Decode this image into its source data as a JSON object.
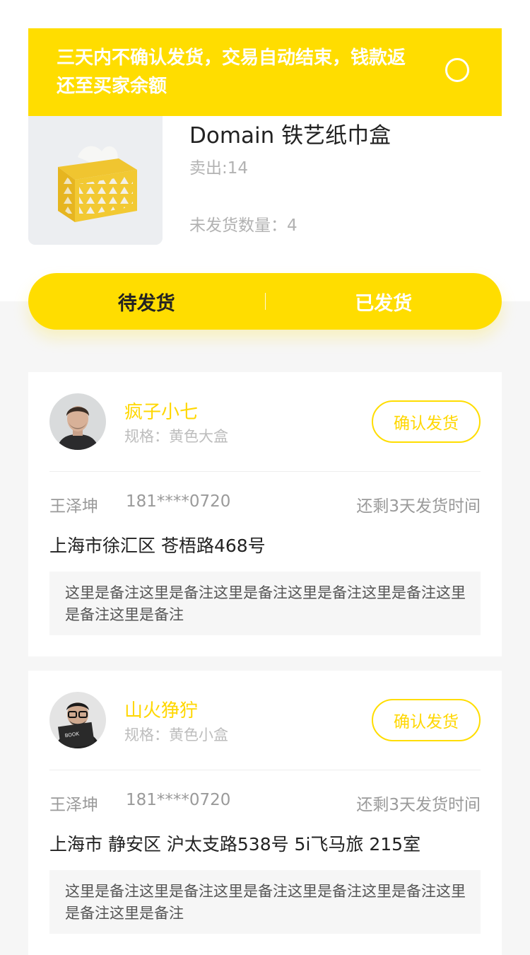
{
  "notice": {
    "text": "三天内不确认发货，交易自动结束，钱款返还至买家余额"
  },
  "product": {
    "title": "Domain 铁艺纸巾盒",
    "sold": "卖出:14",
    "unshipped": "未发货数量：4"
  },
  "tabs": {
    "pending": "待发货",
    "shipped": "已发货",
    "active": "pending"
  },
  "orders": [
    {
      "buyer": "疯子小七",
      "spec": "规格：黄色大盒",
      "confirm": "确认发货",
      "recipient": "王泽坤",
      "phone": "181****0720",
      "remaining": "还剩3天发货时间",
      "address": "上海市徐汇区 苍梧路468号",
      "remark": "这里是备注这里是备注这里是备注这里是备注这里是备注这里是备注这里是备注"
    },
    {
      "buyer": "山火狰狞",
      "spec": "规格：黄色小盒",
      "confirm": "确认发货",
      "recipient": "王泽坤",
      "phone": "181****0720",
      "remaining": "还剩3天发货时间",
      "address": "上海市 静安区 沪太支路538号 5i飞马旅 215室",
      "remark": "这里是备注这里是备注这里是备注这里是备注这里是备注这里是备注这里是备注"
    }
  ],
  "colors": {
    "accent": "#FFDD00",
    "accent_text": "#FFD700",
    "background": "#f6f6f6",
    "muted": "#9a9a9a"
  }
}
